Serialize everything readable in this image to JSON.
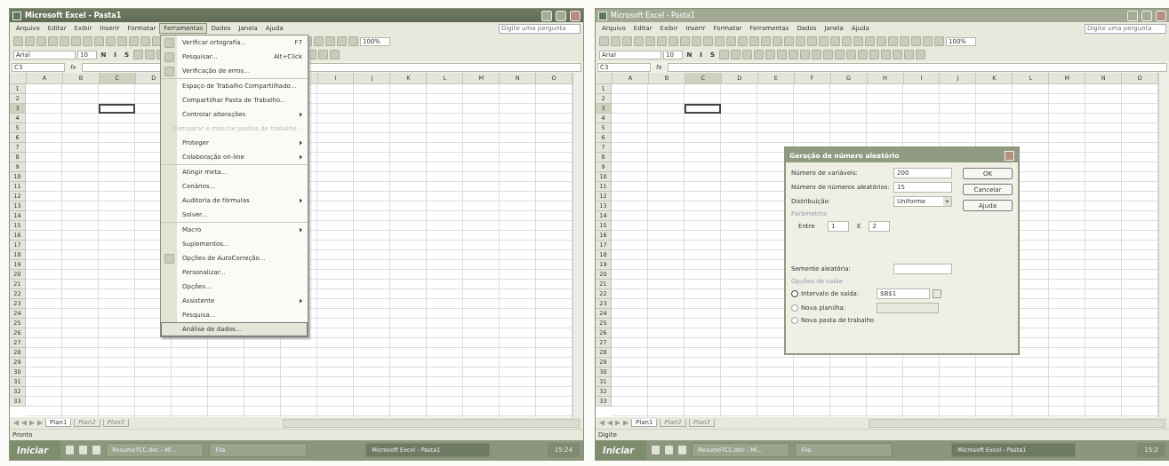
{
  "windows": [
    {
      "title": "Microsoft Excel - Pasta1",
      "active": true,
      "menu_bar": [
        {
          "label": "Arquivo",
          "selected": false
        },
        {
          "label": "Editar",
          "selected": false
        },
        {
          "label": "Exibir",
          "selected": false
        },
        {
          "label": "Inserir",
          "selected": false
        },
        {
          "label": "Formatar",
          "selected": false
        },
        {
          "label": "Ferramentas",
          "selected": true
        },
        {
          "label": "Dados",
          "selected": false
        },
        {
          "label": "Janela",
          "selected": false
        },
        {
          "label": "Ajuda",
          "selected": false
        }
      ],
      "help_box": {
        "placeholder": "Digite uma pergunta"
      },
      "toolbar": {
        "font": "Arial",
        "size": "10",
        "zoom": "100%",
        "format_buttons": [
          "N",
          "I",
          "S"
        ]
      },
      "name_box": "C3",
      "fx": "fx",
      "columns": [
        {
          "label": "A",
          "selected": false
        },
        {
          "label": "B",
          "selected": false
        },
        {
          "label": "C",
          "selected": true
        },
        {
          "label": "D",
          "selected": false
        },
        {},
        {},
        {},
        {},
        {
          "label": "I",
          "selected": false
        },
        {
          "label": "J",
          "selected": false
        },
        {
          "label": "K",
          "selected": false
        },
        {
          "label": "L",
          "selected": false
        },
        {
          "label": "M",
          "selected": false
        },
        {
          "label": "N",
          "selected": false
        },
        {
          "label": "O",
          "selected": false
        }
      ],
      "rows": [
        {
          "label": "1",
          "selected": false
        },
        {
          "label": "2",
          "selected": false
        },
        {
          "label": "3",
          "selected": true
        },
        {
          "label": "4",
          "selected": false
        },
        {
          "label": "5",
          "selected": false
        },
        {
          "label": "6",
          "selected": false
        },
        {
          "label": "7",
          "selected": false
        },
        {
          "label": "8",
          "selected": false
        },
        {
          "label": "9",
          "selected": false
        },
        {
          "label": "10",
          "selected": false
        },
        {
          "label": "11",
          "selected": false
        },
        {
          "label": "12",
          "selected": false
        },
        {
          "label": "13",
          "selected": false
        },
        {
          "label": "14",
          "selected": false
        },
        {
          "label": "15",
          "selected": false
        },
        {
          "label": "16",
          "selected": false
        },
        {
          "label": "17",
          "selected": false
        },
        {
          "label": "18",
          "selected": false
        },
        {
          "label": "19",
          "selected": false
        },
        {
          "label": "20",
          "selected": false
        },
        {
          "label": "21",
          "selected": false
        },
        {
          "label": "22",
          "selected": false
        },
        {
          "label": "23",
          "selected": false
        },
        {
          "label": "24",
          "selected": false
        },
        {
          "label": "25",
          "selected": false
        },
        {
          "label": "26",
          "selected": false
        },
        {
          "label": "27",
          "selected": false
        },
        {
          "label": "28",
          "selected": false
        },
        {
          "label": "29",
          "selected": false
        },
        {
          "label": "30",
          "selected": false
        },
        {
          "label": "31",
          "selected": false
        },
        {
          "label": "32",
          "selected": false
        },
        {
          "label": "33",
          "selected": false
        }
      ],
      "sheet_tabs": [
        {
          "label": "Plan1",
          "selected": true
        },
        {
          "label": "Plan2",
          "selected": false
        },
        {
          "label": "Plan3",
          "selected": false
        }
      ],
      "status": "Pronto",
      "taskbar": {
        "start": "Iniciar",
        "tasks": [
          {
            "label": "ResumoTCC.doc - Mi...",
            "selected": false
          },
          {
            "label": "Fila",
            "selected": false
          },
          {
            "label": "Microsoft Excel - Pasta1",
            "selected": true
          }
        ],
        "clock": "15:24"
      },
      "dropdown_menu": {
        "groups": [
          [
            {
              "label": "Verificar ortografia...",
              "shortcut": "F7",
              "icon": true,
              "submenu": false,
              "disabled": false,
              "selected": false
            },
            {
              "label": "Pesquisar...",
              "shortcut": "Alt+Click",
              "icon": true,
              "submenu": false,
              "disabled": false,
              "selected": false
            },
            {
              "label": "Verificação de erros...",
              "icon": true,
              "submenu": false,
              "disabled": false,
              "selected": false
            }
          ],
          [
            {
              "label": "Espaço de Trabalho Compartilhado...",
              "icon": false,
              "submenu": false,
              "disabled": false,
              "selected": false
            },
            {
              "label": "Compartilhar Pasta de Trabalho...",
              "icon": false,
              "submenu": false,
              "disabled": false,
              "selected": false
            },
            {
              "label": "Controlar alterações",
              "icon": false,
              "submenu": true,
              "disabled": false,
              "selected": false
            },
            {
              "label": "Comparar e mesclar pastas de trabalho...",
              "icon": false,
              "submenu": false,
              "disabled": true,
              "selected": false
            },
            {
              "label": "Proteger",
              "icon": false,
              "submenu": true,
              "disabled": false,
              "selected": false
            },
            {
              "label": "Colaboração on-line",
              "icon": false,
              "submenu": true,
              "disabled": false,
              "selected": false
            }
          ],
          [
            {
              "label": "Atingir meta...",
              "icon": false,
              "submenu": false,
              "disabled": false,
              "selected": false
            },
            {
              "label": "Cenários...",
              "icon": false,
              "submenu": false,
              "disabled": false,
              "selected": false
            },
            {
              "label": "Auditoria de fórmulas",
              "icon": false,
              "submenu": true,
              "disabled": false,
              "selected": false
            },
            {
              "label": "Solver...",
              "icon": false,
              "submenu": false,
              "disabled": false,
              "selected": false
            }
          ],
          [
            {
              "label": "Macro",
              "icon": false,
              "submenu": true,
              "disabled": false,
              "selected": false
            },
            {
              "label": "Suplementos...",
              "icon": false,
              "submenu": false,
              "disabled": false,
              "selected": false
            },
            {
              "label": "Opções de AutoCorreção...",
              "icon": true,
              "submenu": false,
              "disabled": false,
              "selected": false
            },
            {
              "label": "Personalizar...",
              "icon": false,
              "submenu": false,
              "disabled": false,
              "selected": false
            },
            {
              "label": "Opções...",
              "icon": false,
              "submenu": false,
              "disabled": false,
              "selected": false
            },
            {
              "label": "Assistente",
              "icon": false,
              "submenu": true,
              "disabled": false,
              "selected": false
            },
            {
              "label": "Pesquisa...",
              "icon": false,
              "submenu": false,
              "disabled": false,
              "selected": false
            },
            {
              "label": "Análise de dados...",
              "icon": false,
              "submenu": false,
              "disabled": false,
              "selected": true
            }
          ]
        ]
      }
    },
    {
      "title": "Microsoft Excel - Pasta1",
      "active": false,
      "menu_bar": [
        {
          "label": "Arquivo",
          "selected": false
        },
        {
          "label": "Editar",
          "selected": false
        },
        {
          "label": "Exibir",
          "selected": false
        },
        {
          "label": "Inserir",
          "selected": false
        },
        {
          "label": "Formatar",
          "selected": false
        },
        {
          "label": "Ferramentas",
          "selected": false
        },
        {
          "label": "Dados",
          "selected": false
        },
        {
          "label": "Janela",
          "selected": false
        },
        {
          "label": "Ajuda",
          "selected": false
        }
      ],
      "help_box": {
        "placeholder": "Digite uma pergunta"
      },
      "toolbar": {
        "font": "Arial",
        "size": "10",
        "zoom": "100%",
        "format_buttons": [
          "N",
          "I",
          "S"
        ]
      },
      "name_box": "C3",
      "fx": "fx",
      "columns": [
        {
          "label": "A",
          "selected": false
        },
        {
          "label": "B",
          "selected": false
        },
        {
          "label": "C",
          "selected": true
        },
        {
          "label": "D",
          "selected": false
        },
        {
          "label": "E",
          "selected": false
        },
        {
          "label": "F",
          "selected": false
        },
        {
          "label": "G",
          "selected": false
        },
        {
          "label": "H",
          "selected": false
        },
        {
          "label": "I",
          "selected": false
        },
        {
          "label": "J",
          "selected": false
        },
        {
          "label": "K",
          "selected": false
        },
        {
          "label": "L",
          "selected": false
        },
        {
          "label": "M",
          "selected": false
        },
        {
          "label": "N",
          "selected": false
        },
        {
          "label": "O",
          "selected": false
        }
      ],
      "rows": [
        {
          "label": "1",
          "selected": false
        },
        {
          "label": "2",
          "selected": false
        },
        {
          "label": "3",
          "selected": true
        },
        {
          "label": "4",
          "selected": false
        },
        {
          "label": "5",
          "selected": false
        },
        {
          "label": "6",
          "selected": false
        },
        {
          "label": "7",
          "selected": false
        },
        {
          "label": "8",
          "selected": false
        },
        {
          "label": "9",
          "selected": false
        },
        {
          "label": "10",
          "selected": false
        },
        {
          "label": "11",
          "selected": false
        },
        {
          "label": "12",
          "selected": false
        },
        {
          "label": "13",
          "selected": false
        },
        {
          "label": "14",
          "selected": false
        },
        {
          "label": "15",
          "selected": false
        },
        {
          "label": "16",
          "selected": false
        },
        {
          "label": "17",
          "selected": false
        },
        {
          "label": "18",
          "selected": false
        },
        {
          "label": "19",
          "selected": false
        },
        {
          "label": "20",
          "selected": false
        },
        {
          "label": "21",
          "selected": false
        },
        {
          "label": "22",
          "selected": false
        },
        {
          "label": "23",
          "selected": false
        },
        {
          "label": "24",
          "selected": false
        },
        {
          "label": "25",
          "selected": false
        },
        {
          "label": "26",
          "selected": false
        },
        {
          "label": "27",
          "selected": false
        },
        {
          "label": "28",
          "selected": false
        },
        {
          "label": "29",
          "selected": false
        },
        {
          "label": "30",
          "selected": false
        },
        {
          "label": "31",
          "selected": false
        },
        {
          "label": "32",
          "selected": false
        },
        {
          "label": "33",
          "selected": false
        }
      ],
      "sheet_tabs": [
        {
          "label": "Plan1",
          "selected": true
        },
        {
          "label": "Plan2",
          "selected": false
        },
        {
          "label": "Plan3",
          "selected": false
        }
      ],
      "status": "Digite",
      "taskbar": {
        "start": "Iniciar",
        "tasks": [
          {
            "label": "ResumoTCC.doc - Mi...",
            "selected": false
          },
          {
            "label": "Fila",
            "selected": false
          },
          {
            "label": "Microsoft Excel - Pasta1",
            "selected": true
          }
        ],
        "clock": "15:2"
      },
      "dialog": {
        "title": "Geração de número aleatório",
        "fields": [
          {
            "label": "Número de variáveis:",
            "value": "200"
          },
          {
            "label": "Número de números aleatórios:",
            "value": "15"
          }
        ],
        "distribution": {
          "label": "Distribuição:",
          "value": "Uniforme"
        },
        "buttons": [
          "OK",
          "Cancelar",
          "Ajuda"
        ],
        "parameters": {
          "title": "Parâmetros",
          "between": "Entre",
          "from": "1",
          "and": "E",
          "to": "2"
        },
        "seed": {
          "label": "Semente aleatória:"
        },
        "output": {
          "title": "Opções de saída",
          "options": [
            {
              "label": "Intervalo de saída:",
              "selected": true,
              "kind": "range",
              "value": "$B$1"
            },
            {
              "label": "Nova planilha:",
              "selected": false,
              "kind": "field"
            },
            {
              "label": "Nova pasta de trabalho",
              "selected": false,
              "kind": "plain"
            }
          ]
        }
      }
    }
  ]
}
